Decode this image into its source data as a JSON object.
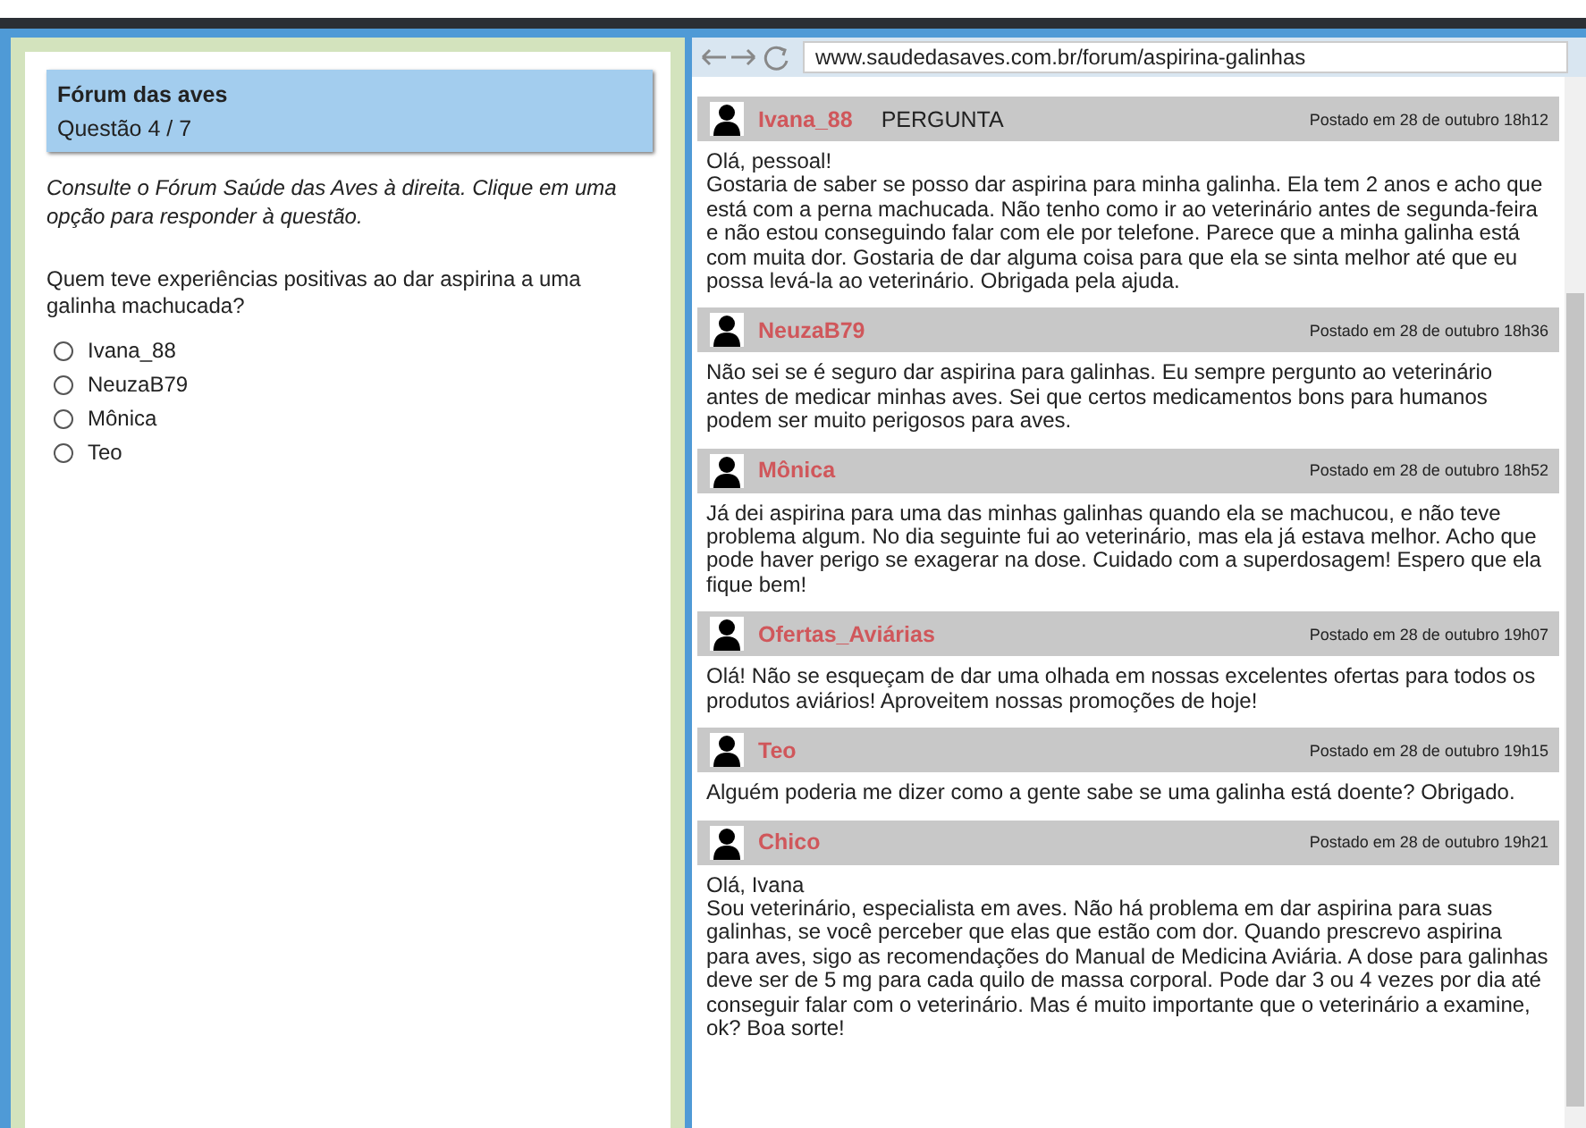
{
  "quiz": {
    "title": "Fórum das aves",
    "progress": "Questão 4 / 7",
    "instruction": "Consulte o Fórum Saúde das Aves à direita. Clique em uma opção para responder à questão.",
    "question": "Quem teve experiências positivas ao dar aspirina a uma galinha machucada?",
    "options": [
      {
        "label": "Ivana_88",
        "selected": false
      },
      {
        "label": "NeuzaB79",
        "selected": false
      },
      {
        "label": "Mônica",
        "selected": false
      },
      {
        "label": "Teo",
        "selected": false
      }
    ]
  },
  "browser": {
    "url": "www.saudedasaves.com.br/forum/aspirina-galinhas",
    "posts": [
      {
        "author": "Ivana_88",
        "tag": "PERGUNTA",
        "posted": "Postado em 28 de outubro 18h12",
        "body": "Olá, pessoal!\nGostaria de saber se posso dar aspirina para minha galinha. Ela tem 2 anos e acho que está com a perna machucada. Não tenho como ir ao veterinário antes de segunda-feira e não estou conseguindo falar com ele por telefone. Parece que a minha galinha está com muita dor. Gostaria de dar alguma coisa para que ela se sinta melhor até que eu possa levá-la ao veterinário. Obrigada pela ajuda."
      },
      {
        "author": "NeuzaB79",
        "posted": "Postado em 28 de outubro 18h36",
        "body": "Não sei se é seguro dar aspirina para galinhas. Eu sempre pergunto ao veterinário antes de medicar minhas aves. Sei que certos medicamentos bons para humanos podem ser muito perigosos para aves."
      },
      {
        "author": "Mônica",
        "posted": "Postado em 28 de outubro 18h52",
        "body": "Já dei aspirina para uma das minhas galinhas quando ela se machucou, e não teve problema algum. No dia seguinte fui ao veterinário, mas ela já estava melhor. Acho que pode haver perigo se exagerar na dose. Cuidado com a superdosagem! Espero que ela fique bem!"
      },
      {
        "author": "Ofertas_Aviárias",
        "posted": "Postado em 28 de outubro 19h07",
        "body": "Olá! Não se esqueçam de dar uma olhada em nossas excelentes ofertas para todos os produtos aviários! Aproveitem nossas promoções de hoje!"
      },
      {
        "author": "Teo",
        "posted": "Postado em 28 de outubro 19h15",
        "body": "Alguém poderia me dizer como a gente sabe se uma galinha está doente? Obrigado."
      },
      {
        "author": "Chico",
        "posted": "Postado em 28 de outubro 19h21",
        "body": "Olá, Ivana\nSou veterinário, especialista em aves. Não há problema em dar aspirina para suas galinhas, se você perceber que elas que estão com dor. Quando prescrevo aspirina para aves, sigo as recomendações do Manual de Medicina Aviária. A dose para galinhas deve ser de 5 mg para cada quilo de massa corporal. Pode dar 3 ou 4 vezes por dia até conseguir falar com o veterinário. Mas é muito importante que o veterinário a examine, ok? Boa sorte!"
      }
    ]
  }
}
